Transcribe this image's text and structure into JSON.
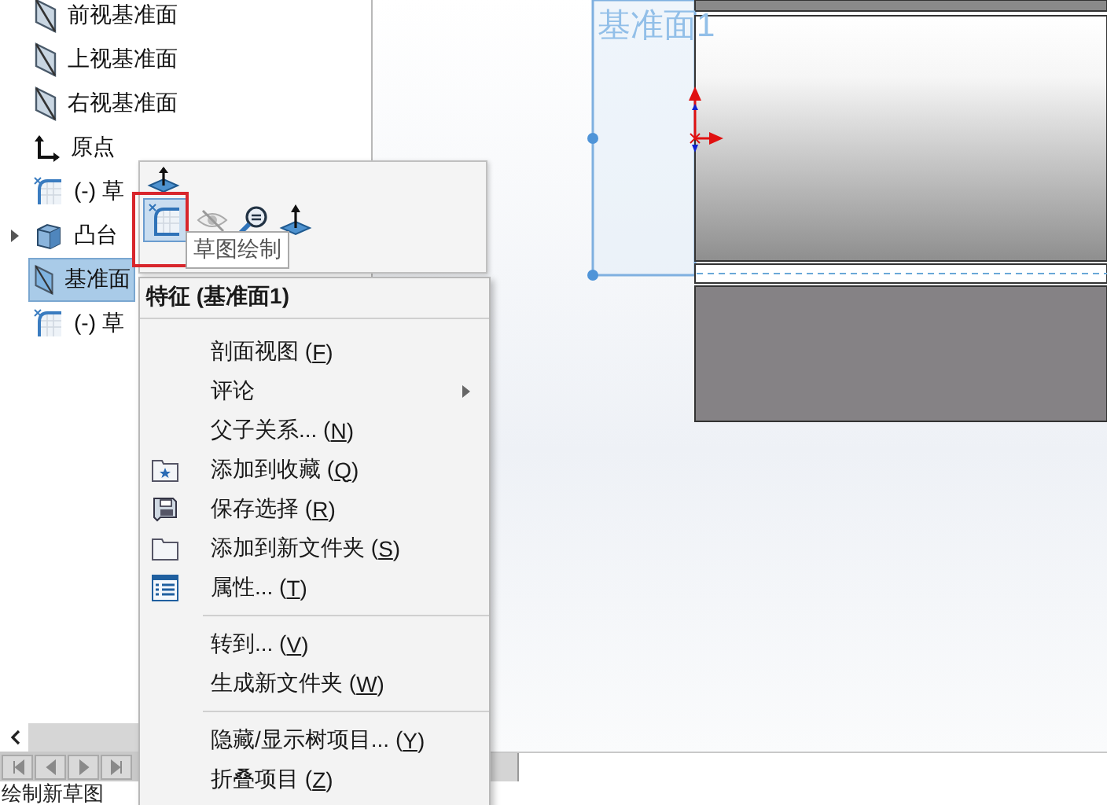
{
  "feature_tree": {
    "items": [
      {
        "kind": "plane",
        "label": "前视基准面",
        "selected": false
      },
      {
        "kind": "plane",
        "label": "上视基准面",
        "selected": false
      },
      {
        "kind": "plane",
        "label": "右视基准面",
        "selected": false
      },
      {
        "kind": "origin",
        "label": "原点",
        "selected": false
      },
      {
        "kind": "sketch",
        "label": "(-) 草",
        "selected": false
      },
      {
        "kind": "boss",
        "label": "凸台",
        "selected": false,
        "expanded": false
      },
      {
        "kind": "plane",
        "label": "基准面",
        "selected": true
      },
      {
        "kind": "sketch",
        "label": "(-) 草",
        "selected": false
      }
    ]
  },
  "context_toolbar": {
    "tooltip": "草图绘制"
  },
  "context_menu": {
    "title": "特征 (基准面1)",
    "sections": [
      [
        {
          "kind": "plain",
          "label": "剖面视图 (F)"
        },
        {
          "kind": "submenu",
          "label": "评论"
        },
        {
          "kind": "plain",
          "label": "父子关系... (N)"
        },
        {
          "kind": "favorite",
          "label": "添加到收藏 (Q)"
        },
        {
          "kind": "save-selection",
          "label": "保存选择 (R)"
        },
        {
          "kind": "folder",
          "label": "添加到新文件夹 (S)"
        },
        {
          "kind": "properties",
          "label": "属性... (T)"
        }
      ],
      [
        {
          "kind": "plain",
          "label": "转到... (V)"
        },
        {
          "kind": "plain",
          "label": "生成新文件夹 (W)"
        }
      ],
      [
        {
          "kind": "plain",
          "label": "隐藏/显示树项目... (Y)"
        },
        {
          "kind": "plain",
          "label": "折叠项目 (Z)"
        }
      ]
    ]
  },
  "viewport": {
    "plane_label": "基准面1"
  },
  "status_bar": {
    "text": "绘制新草图"
  }
}
